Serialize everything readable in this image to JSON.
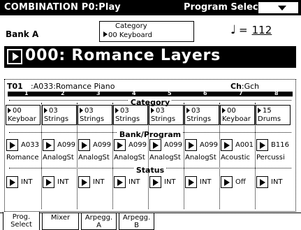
{
  "header": {
    "mode": "COMBINATION P0:Play",
    "page_selector_label": "Program Select",
    "dropdown_icon": "chevron-down-icon"
  },
  "bank": "Bank A",
  "category": {
    "label": "Category",
    "value": "00 Keyboard"
  },
  "tempo": {
    "symbol": "♩",
    "equals": "=",
    "value": "112"
  },
  "program": {
    "name": "000: Romance Layers"
  },
  "timbre": {
    "id_label": "T01",
    "id_rest": ":A033:Romance Piano",
    "channel_label": "Ch",
    "channel_value": ":Gch"
  },
  "timbre_numbers": [
    "1",
    "2",
    "3",
    "4",
    "5",
    "6",
    "7",
    "8"
  ],
  "sections": {
    "category": "Category",
    "bank_program": "Bank/Program",
    "status": "Status"
  },
  "categories": [
    {
      "num": "00",
      "name": "Keyboar"
    },
    {
      "num": "03",
      "name": "Strings"
    },
    {
      "num": "03",
      "name": "Strings"
    },
    {
      "num": "03",
      "name": "Strings"
    },
    {
      "num": "03",
      "name": "Strings"
    },
    {
      "num": "03",
      "name": "Strings"
    },
    {
      "num": "00",
      "name": "Keyboar"
    },
    {
      "num": "15",
      "name": "Drums"
    }
  ],
  "programs": [
    {
      "number": "A033",
      "name": "Romance"
    },
    {
      "number": "A099",
      "name": "AnalogSt"
    },
    {
      "number": "A099",
      "name": "AnalogSt"
    },
    {
      "number": "A099",
      "name": "AnalogSt"
    },
    {
      "number": "A099",
      "name": "AnalogSt"
    },
    {
      "number": "A099",
      "name": "AnalogSt"
    },
    {
      "number": "A001",
      "name": "Acoustic"
    },
    {
      "number": "B116",
      "name": "Percussi"
    }
  ],
  "statuses": [
    "INT",
    "INT",
    "INT",
    "INT",
    "INT",
    "INT",
    "Off",
    "INT"
  ],
  "tabs": [
    {
      "line1": "Prog.",
      "line2": "Select",
      "active": true
    },
    {
      "line1": "Mixer",
      "line2": "",
      "active": false
    },
    {
      "line1": "Arpegg.",
      "line2": "A",
      "active": false
    },
    {
      "line1": "Arpegg.",
      "line2": "B",
      "active": false
    }
  ]
}
